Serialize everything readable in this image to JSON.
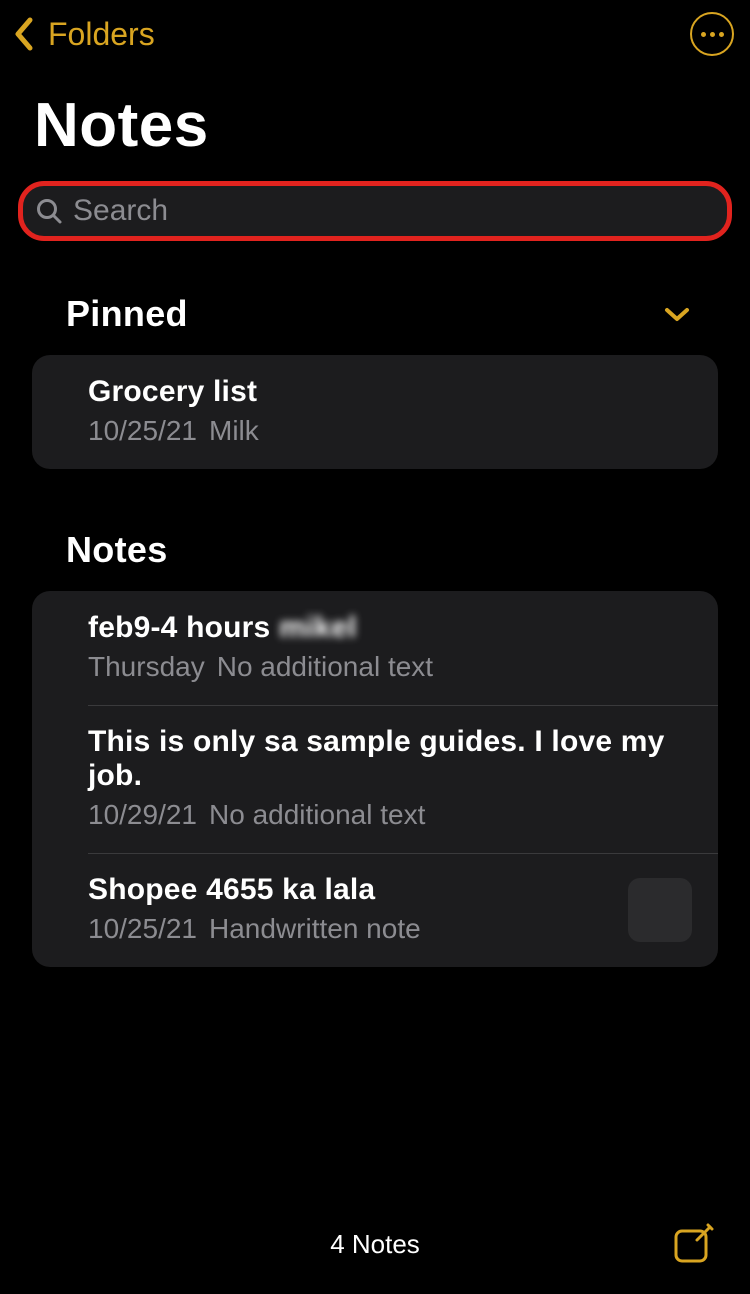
{
  "nav": {
    "back_label": "Folders"
  },
  "page_title": "Notes",
  "search": {
    "placeholder": "Search"
  },
  "sections": {
    "pinned": {
      "title": "Pinned",
      "items": [
        {
          "title": "Grocery list",
          "date": "10/25/21",
          "preview": "Milk"
        }
      ]
    },
    "notes": {
      "title": "Notes",
      "items": [
        {
          "title": "feb9-4 hours",
          "title_blur": "mikel",
          "date": "Thursday",
          "preview": "No additional text"
        },
        {
          "title": "This is only sa sample guides. I love my job.",
          "date": "10/29/21",
          "preview": "No additional text"
        },
        {
          "title": "Shopee 4655 ka lala",
          "date": "10/25/21",
          "preview": "Handwritten note",
          "has_thumb": true
        }
      ]
    }
  },
  "footer": {
    "count_label": "4 Notes"
  },
  "colors": {
    "accent": "#d9a521",
    "highlight_border": "#e1231e"
  }
}
